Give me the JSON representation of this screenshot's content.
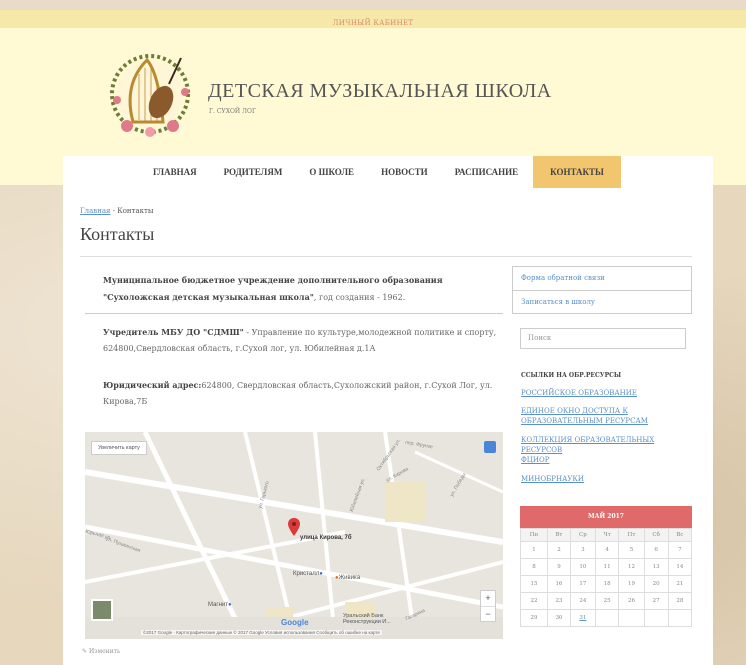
{
  "topbar": {
    "cabinet_link": "ЛИЧНЫЙ КАБИНЕТ"
  },
  "header": {
    "title": "ДЕТСКАЯ МУЗЫКАЛЬНАЯ ШКОЛА",
    "subtitle": "Г. СУХОЙ ЛОГ"
  },
  "nav": {
    "items": [
      {
        "label": "ГЛАВНАЯ"
      },
      {
        "label": "РОДИТЕЛЯМ"
      },
      {
        "label": "О ШКОЛЕ"
      },
      {
        "label": "НОВОСТИ"
      },
      {
        "label": "РАСПИСАНИЕ"
      },
      {
        "label": "КОНТАКТЫ"
      }
    ]
  },
  "breadcrumb": {
    "home": "Главная",
    "separator": " - ",
    "current": "Контакты"
  },
  "page": {
    "title": "Контакты"
  },
  "content": {
    "org_bold": "Муниципальное бюджетное  учреждение дополнительного образования \"Сухоложская детская музыкальная школа\"",
    "org_rest": ", год создания  -  1962.",
    "founder_bold": "Учредитель МБУ ДО \"СДМШ\"",
    "founder_rest": " - Управление по культуре,молодежной политике и спорту, 624800,Свердловская область, г.Сухой лог, ул. Юбилейная д.1А",
    "legal_bold": "Юридический адрес:",
    "legal_rest": "624800, Свердловская область,Сухоложский район, г.Сухой Лог, ул. Кирова,7Б"
  },
  "map": {
    "enlarge_button": "Увеличить карту",
    "marker_label": "улица Кирова, 7б",
    "streets": [
      "ул. Пушкинская",
      "ул. Кирова",
      "Юбилейная ул.",
      "ул. Горького",
      "Октябрьская ул.",
      "Гагарина",
      "ул. Победы",
      "Юрьная ул.",
      "пер. Фрунзе"
    ],
    "places": [
      "Кристалл",
      "Живика",
      "Магнит",
      "Уральский Банк Реконструкции И..."
    ],
    "google_logo": "Google",
    "attribution": "©2017 Google · Картографические данные © 2017 Google   Условия использования   Сообщить об ошибке на карте",
    "zoom_in": "+",
    "zoom_out": "−"
  },
  "edit_link": "Изменить",
  "sidebar": {
    "feedback_link": "Форма обратной связи",
    "enroll_link": "Записаться в школу",
    "search_placeholder": "Поиск",
    "resources_heading": "ССЫЛКИ НА ОБР.РЕСУРСЫ",
    "resources": [
      "РОССИЙСКОЕ ОБРАЗОВАНИЕ",
      "ЕДИНОЕ ОКНО ДОСТУПА К ОБРАЗОВАТЕЛЬНЫМ РЕСУРСАМ",
      "КОЛЛЕКЦИЯ ОБРАЗОВАТЕЛЬНЫХ РЕСУРСОВ",
      "ФЦИОР",
      "МИНОБРНАУКИ"
    ]
  },
  "calendar": {
    "title": "МАЙ 2017",
    "weekdays": [
      "Пн",
      "Вт",
      "Ср",
      "Чт",
      "Пт",
      "Сб",
      "Вс"
    ],
    "weeks": [
      [
        "1",
        "2",
        "3",
        "4",
        "5",
        "6",
        "7"
      ],
      [
        "8",
        "9",
        "10",
        "11",
        "12",
        "13",
        "14"
      ],
      [
        "15",
        "16",
        "17",
        "18",
        "19",
        "20",
        "21"
      ],
      [
        "22",
        "23",
        "24",
        "25",
        "26",
        "27",
        "28"
      ],
      [
        "29",
        "30",
        "31",
        "",
        "",
        "",
        ""
      ]
    ],
    "linked_day": "31"
  },
  "colors": {
    "topbar": "#f6e8a8",
    "header": "#fff9d4",
    "nav_active": "#f2c66e",
    "calendar_head": "#e06a6a",
    "link": "#5a8fc8"
  }
}
